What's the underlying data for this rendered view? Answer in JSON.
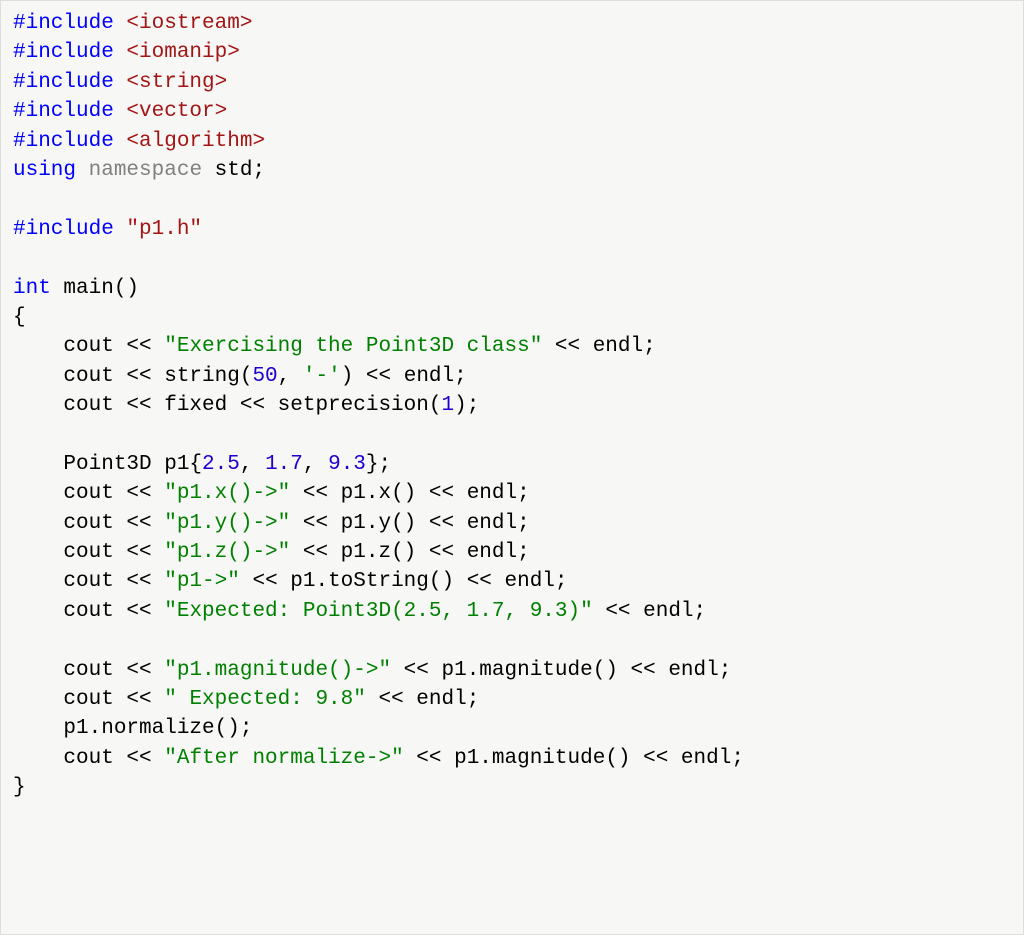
{
  "tokens": [
    [
      [
        "#include ",
        "kw-pp"
      ],
      [
        "<iostream>",
        "header"
      ]
    ],
    [
      [
        "#include ",
        "kw-pp"
      ],
      [
        "<iomanip>",
        "header"
      ]
    ],
    [
      [
        "#include ",
        "kw-pp"
      ],
      [
        "<string>",
        "header"
      ]
    ],
    [
      [
        "#include ",
        "kw-pp"
      ],
      [
        "<vector>",
        "header"
      ]
    ],
    [
      [
        "#include ",
        "kw-pp"
      ],
      [
        "<algorithm>",
        "header"
      ]
    ],
    [
      [
        "using ",
        "kw-using"
      ],
      [
        "namespace ",
        "kw-ns"
      ],
      [
        "std;",
        "plain"
      ]
    ],
    [
      [
        "",
        "plain"
      ]
    ],
    [
      [
        "#include ",
        "kw-pp"
      ],
      [
        "\"p1.h\"",
        "header"
      ]
    ],
    [
      [
        "",
        "plain"
      ]
    ],
    [
      [
        "int ",
        "kw-type"
      ],
      [
        "main()",
        "plain"
      ]
    ],
    [
      [
        "{",
        "plain"
      ]
    ],
    [
      [
        "    cout << ",
        "plain"
      ],
      [
        "\"Exercising the Point3D class\"",
        "str"
      ],
      [
        " << endl;",
        "plain"
      ]
    ],
    [
      [
        "    cout << string(",
        "plain"
      ],
      [
        "50",
        "num"
      ],
      [
        ", ",
        "plain"
      ],
      [
        "'-'",
        "str"
      ],
      [
        ") << endl;",
        "plain"
      ]
    ],
    [
      [
        "    cout << fixed << setprecision(",
        "plain"
      ],
      [
        "1",
        "num"
      ],
      [
        ");",
        "plain"
      ]
    ],
    [
      [
        "",
        "plain"
      ]
    ],
    [
      [
        "    Point3D p1{",
        "plain"
      ],
      [
        "2.5",
        "num"
      ],
      [
        ", ",
        "plain"
      ],
      [
        "1.7",
        "num"
      ],
      [
        ", ",
        "plain"
      ],
      [
        "9.3",
        "num"
      ],
      [
        "};",
        "plain"
      ]
    ],
    [
      [
        "    cout << ",
        "plain"
      ],
      [
        "\"p1.x()->\"",
        "str"
      ],
      [
        " << p1.x() << endl;",
        "plain"
      ]
    ],
    [
      [
        "    cout << ",
        "plain"
      ],
      [
        "\"p1.y()->\"",
        "str"
      ],
      [
        " << p1.y() << endl;",
        "plain"
      ]
    ],
    [
      [
        "    cout << ",
        "plain"
      ],
      [
        "\"p1.z()->\"",
        "str"
      ],
      [
        " << p1.z() << endl;",
        "plain"
      ]
    ],
    [
      [
        "    cout << ",
        "plain"
      ],
      [
        "\"p1->\"",
        "str"
      ],
      [
        " << p1.toString() << endl;",
        "plain"
      ]
    ],
    [
      [
        "    cout << ",
        "plain"
      ],
      [
        "\"Expected: Point3D(2.5, 1.7, 9.3)\"",
        "str"
      ],
      [
        " << endl;",
        "plain"
      ]
    ],
    [
      [
        "",
        "plain"
      ]
    ],
    [
      [
        "    cout << ",
        "plain"
      ],
      [
        "\"p1.magnitude()->\"",
        "str"
      ],
      [
        " << p1.magnitude() << endl;",
        "plain"
      ]
    ],
    [
      [
        "    cout << ",
        "plain"
      ],
      [
        "\" Expected: 9.8\"",
        "str"
      ],
      [
        " << endl;",
        "plain"
      ]
    ],
    [
      [
        "    p1.normalize();",
        "plain"
      ]
    ],
    [
      [
        "    cout << ",
        "plain"
      ],
      [
        "\"After normalize->\"",
        "str"
      ],
      [
        " << p1.magnitude() << endl;",
        "plain"
      ]
    ],
    [
      [
        "}",
        "plain"
      ]
    ]
  ]
}
